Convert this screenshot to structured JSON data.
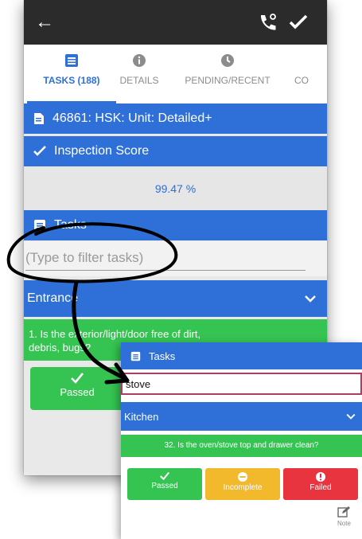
{
  "topbar": {
    "back_icon": "arrow-left-icon",
    "call_icon": "phone-icon",
    "save_icon": "check-icon"
  },
  "tabs": [
    {
      "label": "TASKS (188)",
      "icon": "list-icon"
    },
    {
      "label": "DETAILS",
      "icon": "info-icon"
    },
    {
      "label": "PENDING/RECENT",
      "icon": "clock-icon"
    },
    {
      "label": "CO"
    }
  ],
  "header": {
    "title": "46861: HSK: Unit: Detailed+"
  },
  "inspection": {
    "label": "Inspection Score",
    "score": "99.47 %"
  },
  "tasks_section": {
    "title": "Tasks"
  },
  "filter": {
    "placeholder": "(Type to filter tasks)"
  },
  "category": {
    "label": "Entrance"
  },
  "question": {
    "text": "1. Is the exterior/light/door free of dirt, debris, bugs?"
  },
  "buttons": {
    "passed": "Passed"
  },
  "inset": {
    "title": "Tasks",
    "search_value": "stove",
    "category": "Kitchen",
    "question": "32. Is the oven/stove top and drawer clean?",
    "passed": "Passed",
    "incomplete": "Incomplete",
    "failed": "Failed",
    "note": "Note"
  },
  "colors": {
    "primary_blue": "#2f6fd8",
    "success_green": "#35c452",
    "warning_yellow": "#f2b92c",
    "danger_red": "#e8343e",
    "toolbar_dark": "#2b2b2b"
  }
}
